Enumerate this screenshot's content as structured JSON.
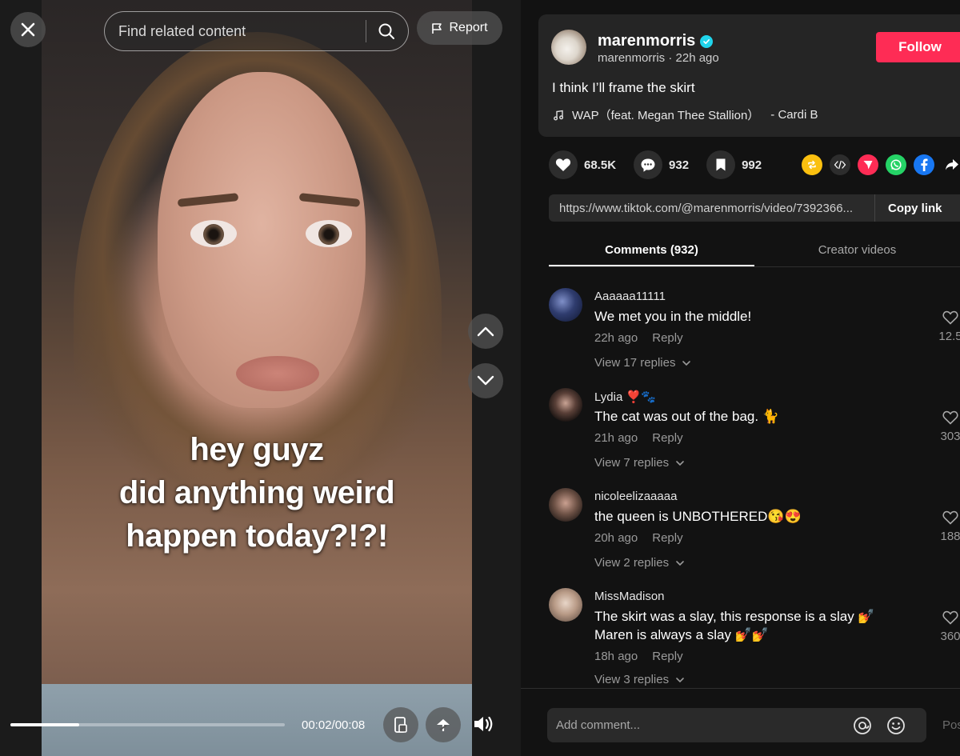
{
  "video": {
    "caption_lines": [
      "hey guyz",
      "did anything weird",
      "happen today?!?!"
    ],
    "search_placeholder": "Find related content",
    "report_label": "Report",
    "time": "00:02/00:08",
    "progress_fraction": 0.25
  },
  "post": {
    "author": "marenmorris",
    "meta": "marenmorris · 22h ago",
    "follow_label": "Follow",
    "description": "I think I’ll frame the skirt",
    "music_title": "WAP（feat. Megan Thee Stallion）",
    "music_artist": "- Cardi B",
    "likes": "68.5K",
    "comments": "932",
    "saves": "992",
    "link": "https://www.tiktok.com/@marenmorris/video/7392366...",
    "copy_link_label": "Copy link"
  },
  "tabs": [
    {
      "label": "Comments (932)",
      "active": true
    },
    {
      "label": "Creator videos",
      "active": false
    }
  ],
  "comments": [
    {
      "user": "Aaaaaa11111",
      "text": "We met you in the middle!",
      "time": "22h ago",
      "reply": "Reply",
      "view_replies": "View 17 replies",
      "likes": "12.5"
    },
    {
      "user": "Lydia ❣️🐾",
      "text": "The cat was out of the bag. 🐈",
      "time": "21h ago",
      "reply": "Reply",
      "view_replies": "View 7 replies",
      "likes": "303"
    },
    {
      "user": "nicoleelizaaaaa",
      "text": "the queen is UNBOTHERED😘😍",
      "time": "20h ago",
      "reply": "Reply",
      "view_replies": "View 2 replies",
      "likes": "188"
    },
    {
      "user": "MissMadison",
      "text": "The skirt was a slay, this response is a slay 💅",
      "text2": "Maren is always a slay 💅💅",
      "time": "18h ago",
      "reply": "Reply",
      "view_replies": "View 3 replies",
      "likes": "360"
    }
  ],
  "composer": {
    "placeholder": "Add comment...",
    "post_label": "Pos"
  },
  "colors": {
    "follow": "#fe2c55",
    "verified": "#20d5ec",
    "repost": "#fbc00f",
    "send": "#fe2c55",
    "whatsapp": "#25d366",
    "facebook": "#1877f2"
  }
}
